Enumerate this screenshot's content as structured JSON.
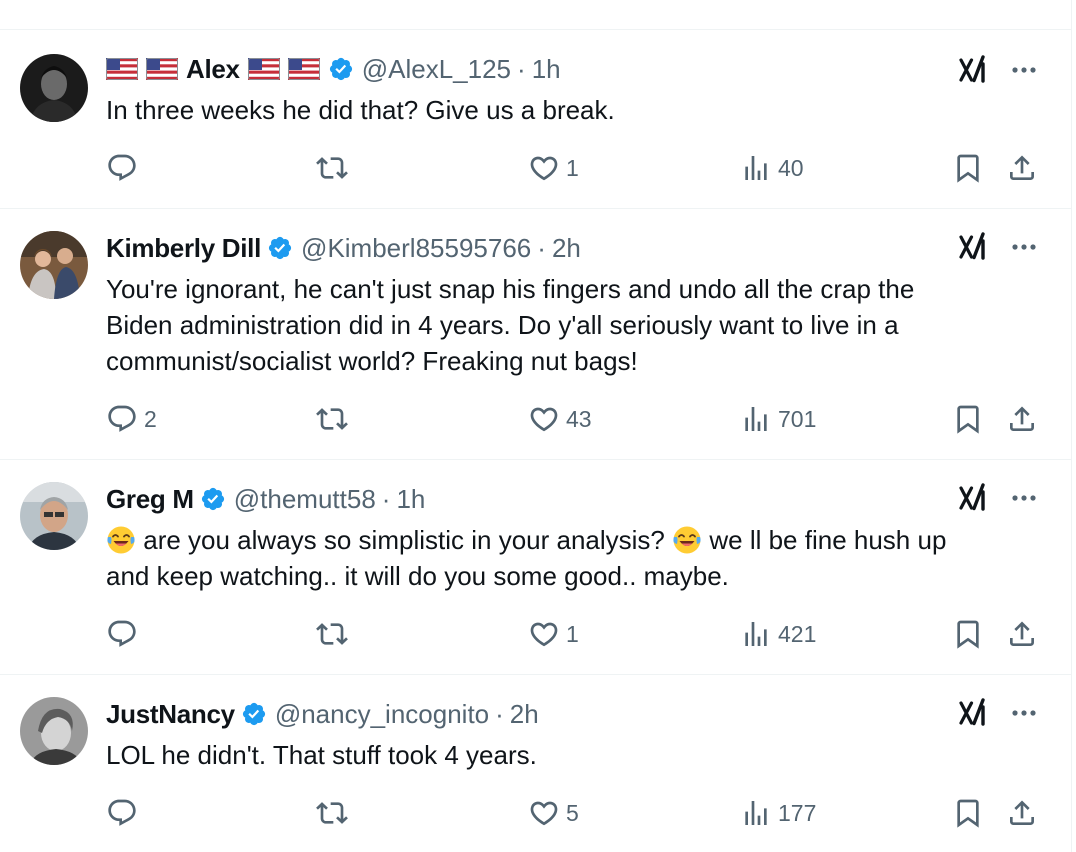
{
  "tweets": [
    {
      "name": "Alex",
      "handle": "@AlexL_125",
      "time": "1h",
      "text": "In three weeks he did that?  Give us a break.",
      "counts": {
        "replies": "",
        "reposts": "",
        "likes": "1",
        "views": "40"
      }
    },
    {
      "name": "Kimberly Dill",
      "handle": "@Kimberl85595766",
      "time": "2h",
      "lines": [
        "You're ignorant, he can't just snap his fingers and undo all the crap the",
        "Biden administration did in 4 years. Do y'all seriously want to live in a",
        "communist/socialist world? Freaking nut bags!"
      ],
      "counts": {
        "replies": "2",
        "reposts": "",
        "likes": "43",
        "views": "701"
      }
    },
    {
      "name": "Greg M",
      "handle": "@themutt58",
      "time": "1h",
      "parts": [
        "are you always so simplistic in your analysis?",
        "we ll be fine hush up"
      ],
      "line2": "and keep watching.. it will do you some good.. maybe.",
      "counts": {
        "replies": "",
        "reposts": "",
        "likes": "1",
        "views": "421"
      }
    },
    {
      "name": "JustNancy",
      "handle": "@nancy_incognito",
      "time": "2h",
      "text": "LOL he didn't.  That stuff took 4 years.",
      "counts": {
        "replies": "",
        "reposts": "",
        "likes": "5",
        "views": "177"
      }
    }
  ],
  "separator": "·",
  "icons": {
    "reply": "reply-icon",
    "repost": "repost-icon",
    "like": "heart-icon",
    "views": "views-icon",
    "bookmark": "bookmark-icon",
    "share": "share-icon",
    "grok": "grok-icon",
    "more": "more-icon",
    "verified": "verified-badge-icon",
    "flag": "us-flag-icon",
    "emoji": "laughing-crying-emoji-icon"
  },
  "colors": {
    "verified": "#1d9bf0",
    "muted": "#536471",
    "text": "#0f1419",
    "divider": "#eff3f4"
  }
}
